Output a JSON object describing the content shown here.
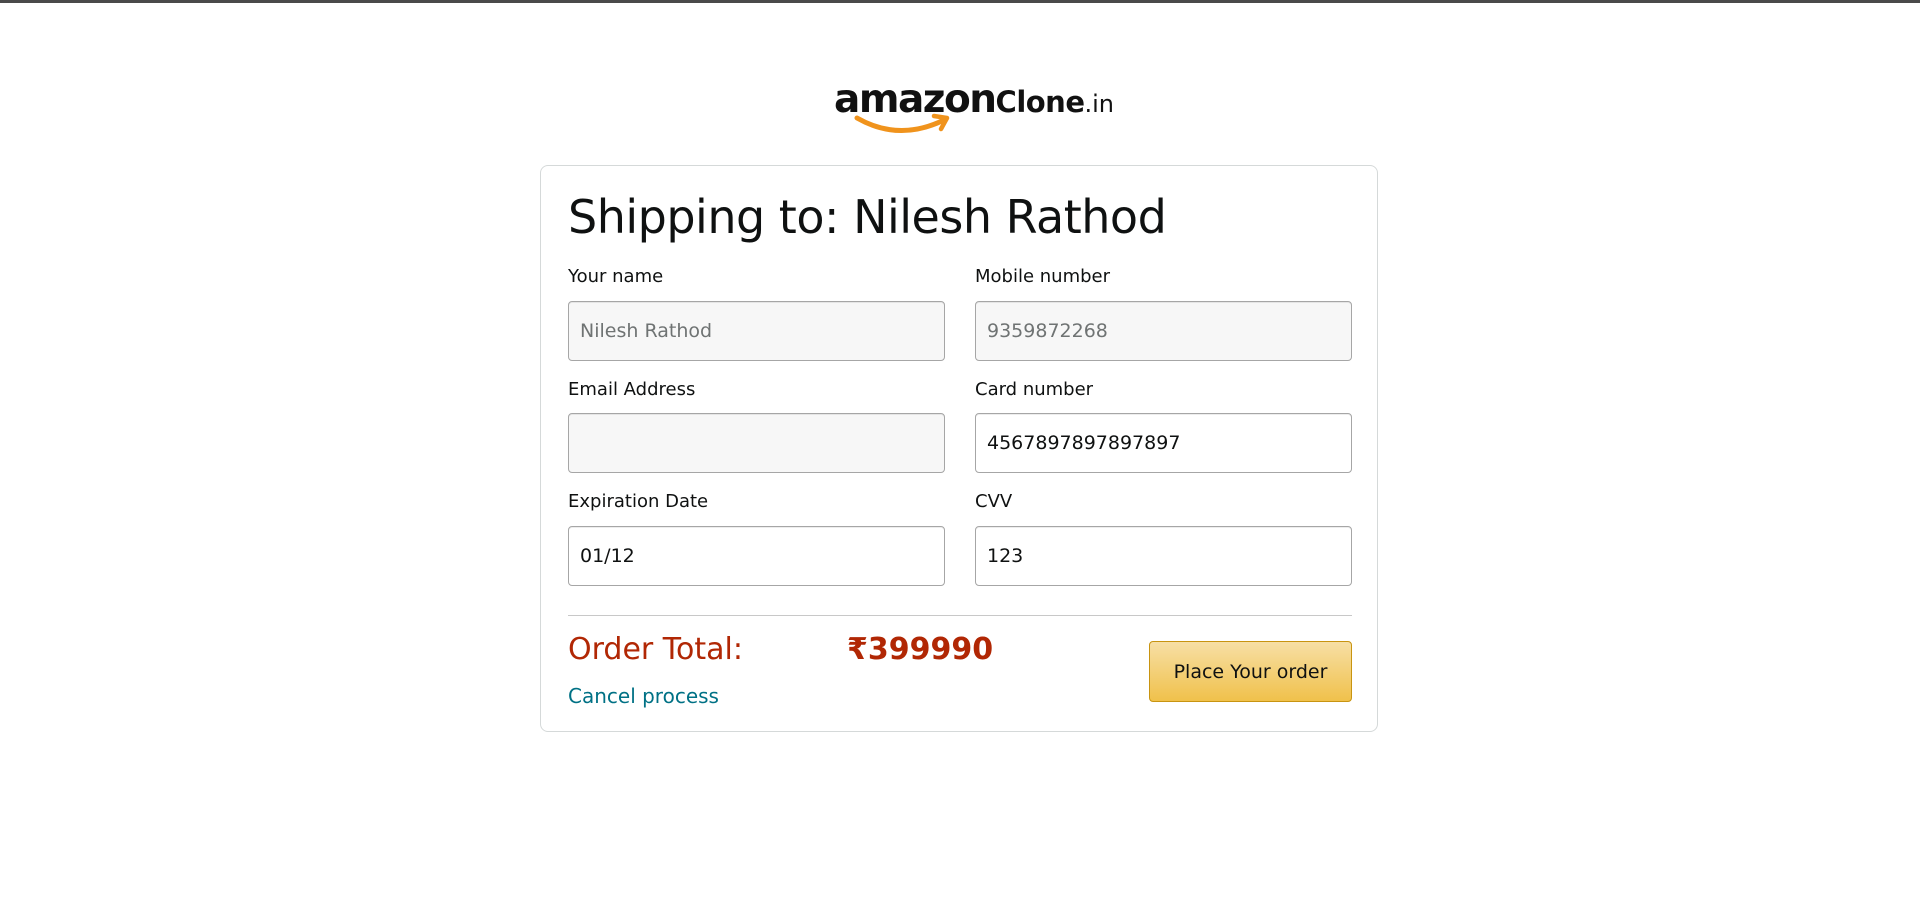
{
  "logo": {
    "brand": "amazon",
    "suffix": "Clone",
    "tld": ".in"
  },
  "checkout": {
    "title": "Shipping to: Nilesh Rathod",
    "fields": {
      "name": {
        "label": "Your name",
        "value": "",
        "placeholder": "Nilesh Rathod"
      },
      "mobile": {
        "label": "Mobile number",
        "value": "",
        "placeholder": "9359872268"
      },
      "email": {
        "label": "Email Address",
        "value": "",
        "placeholder": ""
      },
      "card": {
        "label": "Card number",
        "value": "4567897897897897",
        "placeholder": ""
      },
      "expiry": {
        "label": "Expiration Date",
        "value": "01/12",
        "placeholder": ""
      },
      "cvv": {
        "label": "CVV",
        "value": "123",
        "placeholder": ""
      }
    },
    "order_total_label": "Order Total:",
    "order_total_value": "₹399990",
    "cancel_label": "Cancel process",
    "place_order_label": "Place Your order"
  },
  "colors": {
    "price": "#b12704",
    "link": "#007185",
    "button": "#f0c14b",
    "logo_smile": "#f0931c"
  },
  "icons": {
    "logo_smile": "amazon-smile-arrow-icon"
  }
}
